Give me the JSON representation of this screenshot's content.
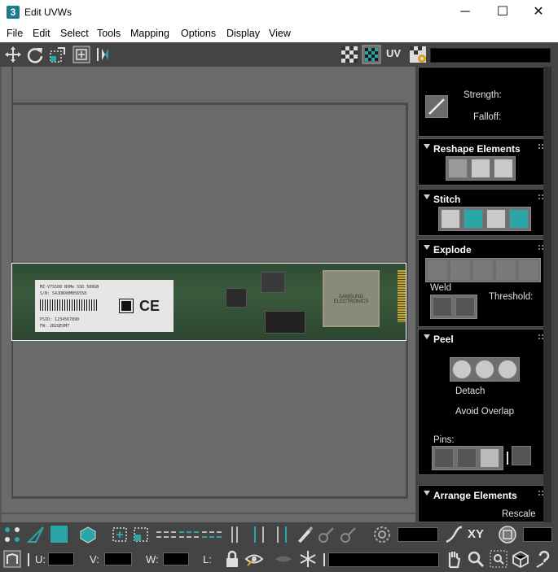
{
  "window": {
    "app_icon": "3",
    "title": "Edit UVWs",
    "controls": {
      "minimize": "─",
      "maximize": "☐",
      "close": "✕"
    }
  },
  "menu": [
    "File",
    "Edit",
    "Select",
    "Tools",
    "Mapping",
    "Options",
    "Display",
    "View"
  ],
  "toolbar_top": {
    "uv_label": "UV",
    "icons": [
      "move-icon",
      "rotate-icon",
      "scale-icon",
      "freeform-icon",
      "mirror-icon",
      "checker-icon",
      "texture-map-icon",
      "settings-icon"
    ]
  },
  "board_label": {
    "lines": [
      "MZ-V7S500 NVMe SSD 500GB",
      "S/N: S4JDNX0M856558",
      "PSID: 1234567890",
      "FW: 2B2QEXM7",
      "SAMSUNG ELECTRONICS"
    ]
  },
  "panel": {
    "soft_select": {
      "strength_label": "Strength:",
      "falloff_label": "Falloff:"
    },
    "rollouts": {
      "reshape": "Reshape Elements",
      "stitch": "Stitch",
      "explode": "Explode",
      "peel": "Peel",
      "arrange": "Arrange Elements"
    },
    "explode": {
      "weld_label": "Weld",
      "threshold_label": "Threshold:"
    },
    "peel": {
      "detach_label": "Detach",
      "avoid_overlap_label": "Avoid Overlap",
      "pins_label": "Pins:"
    },
    "arrange": {
      "rescale_label": "Rescale"
    }
  },
  "toolbar_bottom": {
    "xy_label": "XY",
    "u_label": "U:",
    "v_label": "V:",
    "w_label": "W:",
    "l_label": "L:"
  },
  "colors": {
    "accent": "#2aa6a6",
    "panel_bg": "#444444",
    "viewport_bg": "#6a6a6a"
  }
}
